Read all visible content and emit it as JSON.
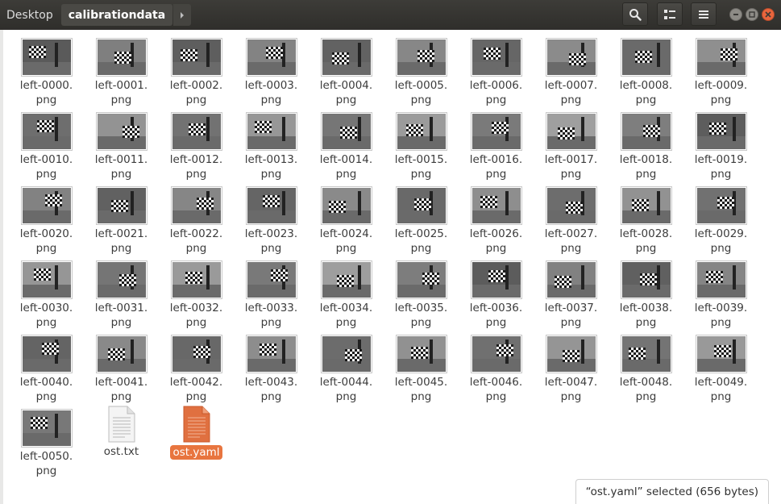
{
  "header": {
    "crumbs": [
      "Desktop",
      "calibrationdata"
    ],
    "buttons": [
      "search-icon",
      "view-options-icon",
      "menu-icon"
    ],
    "window_controls": [
      "minimize-icon",
      "maximize-icon",
      "close-icon"
    ]
  },
  "files": [
    {
      "line1": "left-0000.",
      "line2": "png"
    },
    {
      "line1": "left-0001.",
      "line2": "png"
    },
    {
      "line1": "left-0002.",
      "line2": "png"
    },
    {
      "line1": "left-0003.",
      "line2": "png"
    },
    {
      "line1": "left-0004.",
      "line2": "png"
    },
    {
      "line1": "left-0005.",
      "line2": "png"
    },
    {
      "line1": "left-0006.",
      "line2": "png"
    },
    {
      "line1": "left-0007.",
      "line2": "png"
    },
    {
      "line1": "left-0008.",
      "line2": "png"
    },
    {
      "line1": "left-0009.",
      "line2": "png"
    },
    {
      "line1": "left-0010.",
      "line2": "png"
    },
    {
      "line1": "left-0011.",
      "line2": "png"
    },
    {
      "line1": "left-0012.",
      "line2": "png"
    },
    {
      "line1": "left-0013.",
      "line2": "png"
    },
    {
      "line1": "left-0014.",
      "line2": "png"
    },
    {
      "line1": "left-0015.",
      "line2": "png"
    },
    {
      "line1": "left-0016.",
      "line2": "png"
    },
    {
      "line1": "left-0017.",
      "line2": "png"
    },
    {
      "line1": "left-0018.",
      "line2": "png"
    },
    {
      "line1": "left-0019.",
      "line2": "png"
    },
    {
      "line1": "left-0020.",
      "line2": "png"
    },
    {
      "line1": "left-0021.",
      "line2": "png"
    },
    {
      "line1": "left-0022.",
      "line2": "png"
    },
    {
      "line1": "left-0023.",
      "line2": "png"
    },
    {
      "line1": "left-0024.",
      "line2": "png"
    },
    {
      "line1": "left-0025.",
      "line2": "png"
    },
    {
      "line1": "left-0026.",
      "line2": "png"
    },
    {
      "line1": "left-0027.",
      "line2": "png"
    },
    {
      "line1": "left-0028.",
      "line2": "png"
    },
    {
      "line1": "left-0029.",
      "line2": "png"
    },
    {
      "line1": "left-0030.",
      "line2": "png"
    },
    {
      "line1": "left-0031.",
      "line2": "png"
    },
    {
      "line1": "left-0032.",
      "line2": "png"
    },
    {
      "line1": "left-0033.",
      "line2": "png"
    },
    {
      "line1": "left-0034.",
      "line2": "png"
    },
    {
      "line1": "left-0035.",
      "line2": "png"
    },
    {
      "line1": "left-0036.",
      "line2": "png"
    },
    {
      "line1": "left-0037.",
      "line2": "png"
    },
    {
      "line1": "left-0038.",
      "line2": "png"
    },
    {
      "line1": "left-0039.",
      "line2": "png"
    },
    {
      "line1": "left-0040.",
      "line2": "png"
    },
    {
      "line1": "left-0041.",
      "line2": "png"
    },
    {
      "line1": "left-0042.",
      "line2": "png"
    },
    {
      "line1": "left-0043.",
      "line2": "png"
    },
    {
      "line1": "left-0044.",
      "line2": "png"
    },
    {
      "line1": "left-0045.",
      "line2": "png"
    },
    {
      "line1": "left-0046.",
      "line2": "png"
    },
    {
      "line1": "left-0047.",
      "line2": "png"
    },
    {
      "line1": "left-0048.",
      "line2": "png"
    },
    {
      "line1": "left-0049.",
      "line2": "png"
    },
    {
      "line1": "left-0050.",
      "line2": "png"
    }
  ],
  "other_files": [
    {
      "name": "ost.txt",
      "icon": "text-file-icon",
      "selected": false
    },
    {
      "name": "ost.yaml",
      "icon": "yaml-file-icon",
      "selected": true
    }
  ],
  "status": {
    "text": "“ost.yaml” selected  (656 bytes)"
  },
  "colors": {
    "header_bg": "#3d3c38",
    "selection": "#e8753f",
    "close_button": "#e8653d"
  }
}
